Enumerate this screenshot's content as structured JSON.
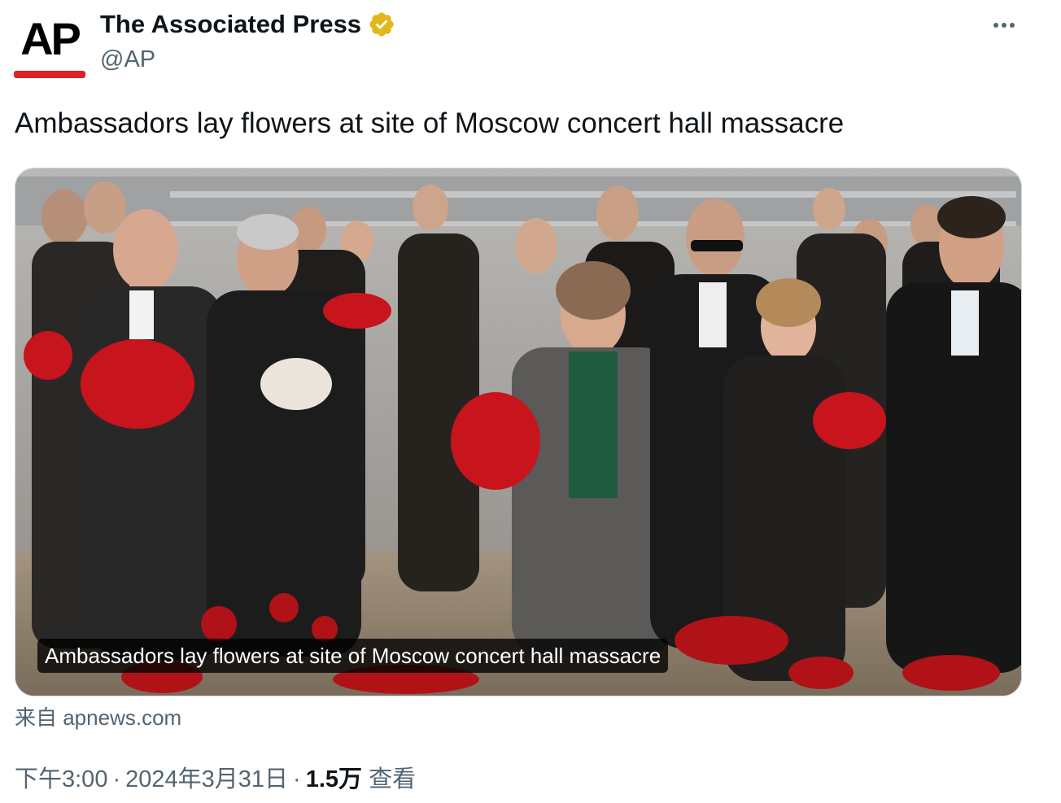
{
  "author": {
    "display_name": "The Associated Press",
    "handle": "@AP",
    "avatar_text": "AP",
    "verified_color": "#e2b719"
  },
  "tweet": {
    "text": "Ambassadors lay flowers at site of Moscow concert hall massacre"
  },
  "card": {
    "image_alt": "Ambassadors holding red flowers at a memorial",
    "caption": "Ambassadors lay flowers at site of Moscow concert hall massacre",
    "source": "来自 apnews.com"
  },
  "meta": {
    "time": "下午3:00",
    "separator": "·",
    "date": "2024年3月31日",
    "views_count": "1.5万",
    "views_label": "查看"
  },
  "colors": {
    "brand_red": "#e41e26",
    "text_primary": "#0f1419",
    "text_secondary": "#536471",
    "border": "#cfd9de"
  }
}
